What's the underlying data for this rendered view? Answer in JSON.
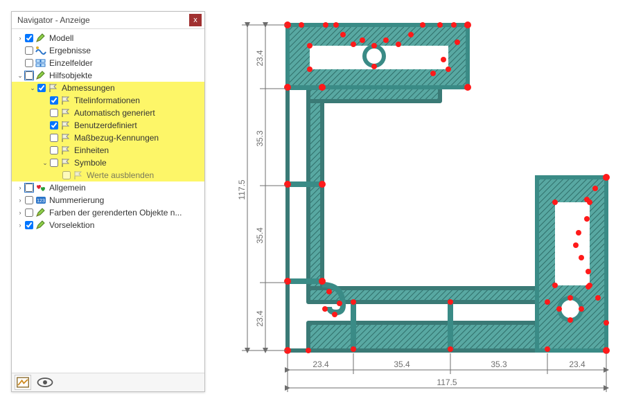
{
  "panel": {
    "title": "Navigator - Anzeige",
    "close_label": "x"
  },
  "tree": [
    {
      "indent": 0,
      "arrow": "right",
      "checked": true,
      "cbStyle": "plain",
      "icon": "pencil",
      "label": "Modell"
    },
    {
      "indent": 0,
      "arrow": "none",
      "checked": false,
      "cbStyle": "plain",
      "icon": "wave",
      "label": "Ergebnisse"
    },
    {
      "indent": 0,
      "arrow": "none",
      "checked": false,
      "cbStyle": "plain",
      "icon": "fields",
      "label": "Einzelfelder"
    },
    {
      "indent": 0,
      "arrow": "down",
      "checked": false,
      "cbStyle": "blue",
      "icon": "pencil",
      "label": "Hilfsobjekte"
    },
    {
      "indent": 1,
      "arrow": "down",
      "checked": true,
      "cbStyle": "plain",
      "icon": "flag",
      "label": "Abmessungen",
      "hl": true
    },
    {
      "indent": 2,
      "arrow": "none",
      "checked": true,
      "cbStyle": "plain",
      "icon": "flag",
      "label": "Titelinformationen",
      "hl": true
    },
    {
      "indent": 2,
      "arrow": "none",
      "checked": false,
      "cbStyle": "plain",
      "icon": "flag",
      "label": "Automatisch generiert",
      "hl": true
    },
    {
      "indent": 2,
      "arrow": "none",
      "checked": true,
      "cbStyle": "plain",
      "icon": "flag",
      "label": "Benutzerdefiniert",
      "hl": true
    },
    {
      "indent": 2,
      "arrow": "none",
      "checked": false,
      "cbStyle": "plain",
      "icon": "flag",
      "label": "Maßbezug-Kennungen",
      "hl": true
    },
    {
      "indent": 2,
      "arrow": "none",
      "checked": false,
      "cbStyle": "plain",
      "icon": "flag",
      "label": "Einheiten",
      "hl": true
    },
    {
      "indent": 2,
      "arrow": "down",
      "checked": false,
      "cbStyle": "plain",
      "icon": "flag",
      "label": "Symbole",
      "hl": true
    },
    {
      "indent": 3,
      "arrow": "none",
      "checked": false,
      "cbStyle": "dim",
      "icon": "flag-dim",
      "label": "Werte ausblenden",
      "hl": true,
      "dim": true
    },
    {
      "indent": 0,
      "arrow": "right",
      "checked": false,
      "cbStyle": "blue",
      "icon": "hearts",
      "label": "Allgemein"
    },
    {
      "indent": 0,
      "arrow": "right",
      "checked": false,
      "cbStyle": "plain",
      "icon": "num",
      "label": "Nummerierung"
    },
    {
      "indent": 0,
      "arrow": "right",
      "checked": false,
      "cbStyle": "plain",
      "icon": "pencil",
      "label": "Farben der gerenderten Objekte n..."
    },
    {
      "indent": 0,
      "arrow": "right",
      "checked": true,
      "cbStyle": "plain",
      "icon": "pencil",
      "label": "Vorselektion"
    }
  ],
  "dimensions": {
    "vertical": [
      {
        "value": "23.4"
      },
      {
        "value": "35.3"
      },
      {
        "value": "35.4"
      },
      {
        "value": "23.4"
      }
    ],
    "vertical_total": "117.5",
    "horizontal": [
      {
        "value": "23.4"
      },
      {
        "value": "35.4"
      },
      {
        "value": "35.3"
      },
      {
        "value": "23.4"
      }
    ],
    "horizontal_total": "117.5"
  },
  "colors": {
    "teal": "#3a8b86",
    "red": "#ff1a1a",
    "dim": "#6e6e6e",
    "highlight": "#fdf668"
  }
}
